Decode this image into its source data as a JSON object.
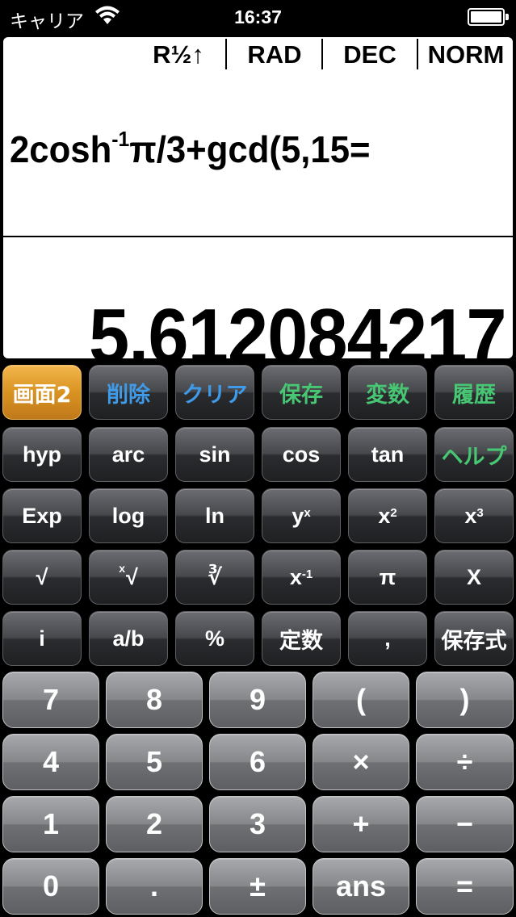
{
  "status_bar": {
    "carrier": "キャリア",
    "time": "16:37"
  },
  "display": {
    "modes": [
      "R½↑",
      "RAD",
      "DEC",
      "NORM"
    ],
    "expression": {
      "prefix": "2cosh",
      "sup": "-1",
      "suffix": "π/3+gcd(5,15="
    },
    "result": "5.612084217"
  },
  "keys": {
    "row1": [
      {
        "label": "画面2",
        "style": "gold"
      },
      {
        "label": "削除",
        "color": "blue"
      },
      {
        "label": "クリア",
        "color": "blue"
      },
      {
        "label": "保存",
        "color": "green"
      },
      {
        "label": "変数",
        "color": "green"
      },
      {
        "label": "履歴",
        "color": "green"
      }
    ],
    "row2": [
      {
        "label": "hyp"
      },
      {
        "label": "arc"
      },
      {
        "label": "sin"
      },
      {
        "label": "cos"
      },
      {
        "label": "tan"
      },
      {
        "label": "ヘルプ",
        "color": "green"
      }
    ],
    "row3": [
      {
        "label": "Exp"
      },
      {
        "label": "log"
      },
      {
        "label": "ln"
      },
      {
        "label": "y",
        "sup": "x"
      },
      {
        "label": "x",
        "sup": "2"
      },
      {
        "label": "x",
        "sup": "3"
      }
    ],
    "row4": [
      {
        "label": "√"
      },
      {
        "label": "√",
        "lsup": "x"
      },
      {
        "label": "∛"
      },
      {
        "label": "x",
        "sup": "-1"
      },
      {
        "label": "π"
      },
      {
        "label": "X"
      }
    ],
    "row5": [
      {
        "label": "i"
      },
      {
        "label": "a/b"
      },
      {
        "label": "%"
      },
      {
        "label": "定数"
      },
      {
        "label": ","
      },
      {
        "label": "保存式"
      }
    ],
    "num1": [
      "7",
      "8",
      "9",
      "(",
      ")"
    ],
    "num2": [
      "4",
      "5",
      "6",
      "×",
      "÷"
    ],
    "num3": [
      "1",
      "2",
      "3",
      "+",
      "−"
    ],
    "num4": [
      "0",
      ".",
      "±",
      "ans",
      "="
    ]
  },
  "colors": {
    "accent_gold": "#d99321",
    "label_blue": "#3f9be8",
    "label_green": "#47c773"
  },
  "icons": [
    "wifi-icon",
    "battery-icon"
  ]
}
